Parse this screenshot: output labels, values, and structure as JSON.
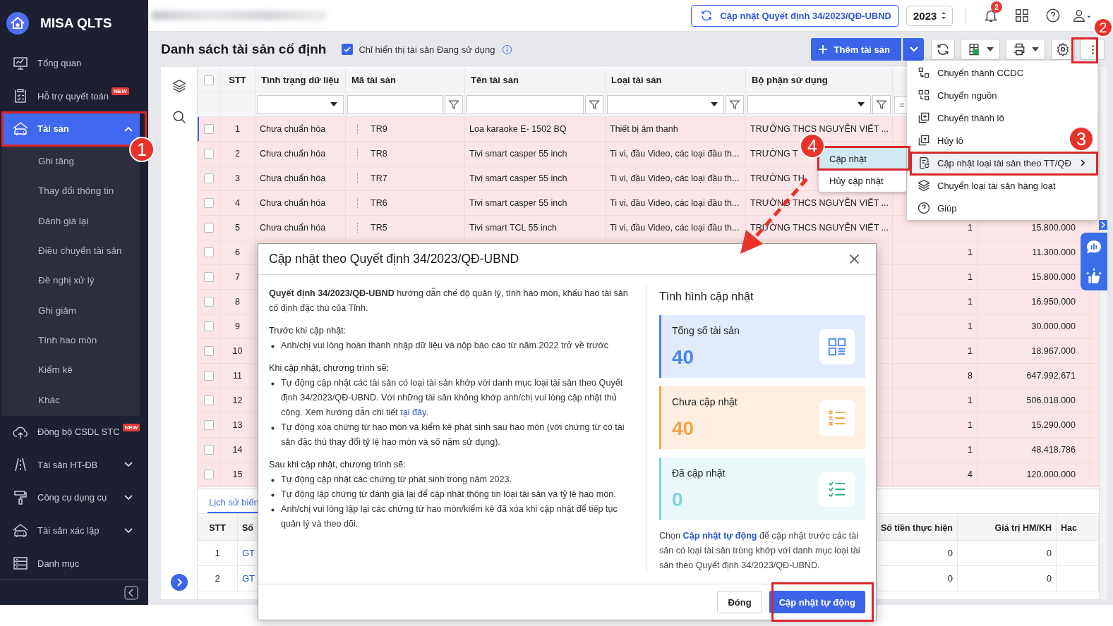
{
  "app": {
    "name": "MISA QLTS"
  },
  "sidebar": {
    "items": [
      {
        "label": "Tổng quan",
        "selected": false
      },
      {
        "label": "Hỗ trợ quyết toán",
        "badge": "NEW",
        "selected": false
      },
      {
        "label": "Tài sản",
        "selected": true,
        "expanded": true,
        "children": [
          {
            "label": "Ghi tăng"
          },
          {
            "label": "Thay đổi thông tin"
          },
          {
            "label": "Đánh giá lại"
          },
          {
            "label": "Điều chuyển tài sản"
          },
          {
            "label": "Đề nghị xử lý"
          },
          {
            "label": "Ghi giảm"
          },
          {
            "label": "Tính hao mòn"
          },
          {
            "label": "Kiểm kê"
          },
          {
            "label": "Khác"
          }
        ]
      },
      {
        "label": "Đồng bộ CSDL STC",
        "badge": "NEW",
        "selected": false
      },
      {
        "label": "Tài sản HT-ĐB",
        "selected": false,
        "expanded": false
      },
      {
        "label": "Công cụ dụng cụ",
        "selected": false,
        "expanded": false
      },
      {
        "label": "Tài sản xác lập",
        "selected": false,
        "expanded": false
      },
      {
        "label": "Danh mục",
        "selected": false
      }
    ]
  },
  "header": {
    "update_button": "Cập nhật Quyết định 34/2023/QĐ-UBND",
    "year": "2023",
    "notification_count": "2"
  },
  "page": {
    "title": "Danh sách tài sản cố định",
    "filter_checkbox": {
      "label": "Chỉ hiển thị tài sản Đang sử dụng",
      "checked": true
    },
    "add_button": "Thêm tài sản"
  },
  "table": {
    "columns": [
      "STT",
      "Tình trạng dữ liệu",
      "Mã tài sản",
      "Tên tài sản",
      "Loại tài sản",
      "Bộ phận sử dụng"
    ],
    "header_checked": false,
    "filters": [
      {
        "kind": "select",
        "filter_button": false
      },
      {
        "kind": "text",
        "filter_button": true
      },
      {
        "kind": "text",
        "filter_button": true
      },
      {
        "kind": "select",
        "filter_button": true
      },
      {
        "kind": "select",
        "filter_button": true
      },
      {
        "kind": "operator",
        "text": "=",
        "filter_button": false
      }
    ],
    "rows": [
      {
        "stt": "1",
        "status": "Chưa chuẩn hóa",
        "code": "TR9",
        "name": "Loa karaoke E- 1502 BQ",
        "type": "Thiết bị âm thanh",
        "dept": "TRƯỜNG THCS NGUYỄN VIẾT ...",
        "checked": false,
        "selected": true
      },
      {
        "stt": "2",
        "status": "Chưa chuẩn hóa",
        "code": "TR8",
        "name": "Tivi smart casper 55 inch",
        "type": "Ti vi, đầu Video, các loại đầu th...",
        "dept": "TRƯỜNG T",
        "checked": false,
        "selected": false
      },
      {
        "stt": "3",
        "status": "Chưa chuẩn hóa",
        "code": "TR7",
        "name": "Tivi smart casper 55 inch",
        "type": "Ti vi, đầu Video, các loại đầu th...",
        "dept": "TRƯỜNG TH",
        "checked": false,
        "selected": false
      },
      {
        "stt": "4",
        "status": "Chưa chuẩn hóa",
        "code": "TR6",
        "name": "Tivi smart casper 55 inch",
        "type": "Ti vi, đầu Video, các loại đầu th...",
        "dept": "TRƯỜNG THCS NGUYỄN VIẾT ...",
        "checked": false,
        "selected": false
      },
      {
        "stt": "5",
        "status": "Chưa chuẩn hóa",
        "code": "TR5",
        "name": "Tivi smart TCL 55 inch",
        "type": "Ti vi, đầu Video, các loại đầu th...",
        "dept": "TRƯỜNG THCS NGUYỄN VIẾT ...",
        "qty": "1",
        "value": "15.800.000",
        "checked": false,
        "selected": false
      },
      {
        "stt": "6",
        "qty": "1",
        "value": "11.300.000",
        "checked": false,
        "selected": false
      },
      {
        "stt": "7",
        "qty": "1",
        "value": "15.800.000",
        "checked": false,
        "selected": false
      },
      {
        "stt": "8",
        "qty": "1",
        "value": "16.950.000",
        "checked": false,
        "selected": false
      },
      {
        "stt": "9",
        "qty": "1",
        "value": "30.000.000",
        "checked": false,
        "selected": false
      },
      {
        "stt": "10",
        "qty": "1",
        "value": "18.967.000",
        "checked": false,
        "selected": false
      },
      {
        "stt": "11",
        "qty": "8",
        "value": "647.992.671",
        "checked": false,
        "selected": false
      },
      {
        "stt": "12",
        "qty": "1",
        "value": "506.018.000",
        "checked": false,
        "selected": false
      },
      {
        "stt": "13",
        "qty": "1",
        "value": "15.290.000",
        "checked": false,
        "selected": false
      },
      {
        "stt": "14",
        "qty": "1",
        "value": "48.418.786",
        "checked": false,
        "selected": false
      },
      {
        "stt": "15",
        "qty": "4",
        "value": "120.000.000",
        "checked": false,
        "selected": false
      }
    ]
  },
  "history": {
    "tab": "Lịch sử biến",
    "columns": [
      "STT",
      "Số",
      "Số tiền thực hiện",
      "Giá trị HM/KH",
      "Hac"
    ],
    "rows": [
      {
        "stt": "1",
        "number": "GT",
        "amount": "0",
        "value": "0"
      },
      {
        "stt": "2",
        "number": "GT",
        "amount": "0",
        "value": "0"
      }
    ]
  },
  "menu": {
    "items": [
      {
        "label": "Chuyển thành CCDC",
        "selected": false,
        "has_submenu": false
      },
      {
        "label": "Chuyển nguồn",
        "selected": false,
        "has_submenu": false
      },
      {
        "label": "Chuyển thành lô",
        "selected": false,
        "has_submenu": false
      },
      {
        "label": "Hủy lô",
        "selected": false,
        "has_submenu": false
      },
      {
        "label": "Cập nhật loại tài sản theo TT/QĐ",
        "selected": true,
        "has_submenu": true
      },
      {
        "label": "Chuyển loại tài sản hàng loạt",
        "selected": false,
        "has_submenu": false
      },
      {
        "label": "Giúp",
        "selected": false,
        "has_submenu": false
      }
    ]
  },
  "submenu": {
    "items": [
      {
        "label": "Cập nhật",
        "selected": true
      },
      {
        "label": "Hủy cập nhật",
        "selected": false
      }
    ]
  },
  "dialog": {
    "title": "Cập nhật theo Quyết định 34/2023/QĐ-UBND",
    "intro": "**Quyết định 34/2023/QĐ-UBND** hướng dẫn chế độ quản lý, tính hao mòn, khấu hao tài sản cố định đặc thù của Tỉnh.",
    "sections": [
      {
        "heading": "Trước khi cập nhật:",
        "bullets": [
          {
            "text": "Anh/chị vui lòng hoàn thành nhập dữ liệu và nộp báo cáo từ năm 2022 trở về trước"
          }
        ]
      },
      {
        "heading": "Khi cập nhật, chương trình sẽ:",
        "bullets": [
          {
            "text": "Tự động cập nhật các tài sản có loại tài sản khớp với danh mục loại tài sản theo Quyết định 34/2023/QĐ-UBND. Với những tài sản không khớp anh/chị vui lòng cập nhật thủ công. Xem hướng dẫn chi tiết ",
            "link": "tại đây",
            "after": "."
          },
          {
            "text": "Tự động xóa chứng từ hao mòn và kiểm kê phát sinh sau hao mòn (với chứng từ có tài sản đặc thù thay đổi tỷ lệ hao mòn và số năm sử dụng)."
          }
        ]
      },
      {
        "heading": "Sau khi cập nhật, chương trình sẽ:",
        "bullets": [
          {
            "text": "Tự động cập nhật các chứng từ phát sinh trong năm 2023."
          },
          {
            "text": "Tự động lập chứng từ đánh giá lại để cập nhật thông tin loại tài sản và tỷ lệ hao mòn."
          },
          {
            "text": "Anh/chị vui lòng lập lại các chứng từ hao mòn/kiểm kê đã xóa khi cập nhật để tiếp tục quản lý và theo dõi."
          }
        ]
      }
    ],
    "status_title": "Tình hình cập nhật",
    "stats": [
      {
        "kind": "total",
        "label": "Tổng số tài sản",
        "value": "40",
        "color": "#4a86ee"
      },
      {
        "kind": "pending",
        "label": "Chưa cập nhật",
        "value": "40",
        "color": "#f2a34b"
      },
      {
        "kind": "done",
        "label": "Đã cập nhật",
        "value": "0",
        "color": "#7fd3d9"
      }
    ],
    "note": {
      "before": "Chọn ",
      "link": "Cập nhật tự động",
      "after": " để cập nhật trước các tài sản có loại tài sản trùng khớp với danh mục loại tài sản theo Quyết định 34/2023/QĐ-UBND."
    },
    "buttons": [
      {
        "label": "Đóng",
        "kind": "secondary"
      },
      {
        "label": "Cập nhật tự động",
        "kind": "primary"
      }
    ]
  },
  "annotations": [
    {
      "label": "2"
    },
    {
      "label": "1"
    },
    {
      "label": "4"
    },
    {
      "label": "3"
    }
  ]
}
